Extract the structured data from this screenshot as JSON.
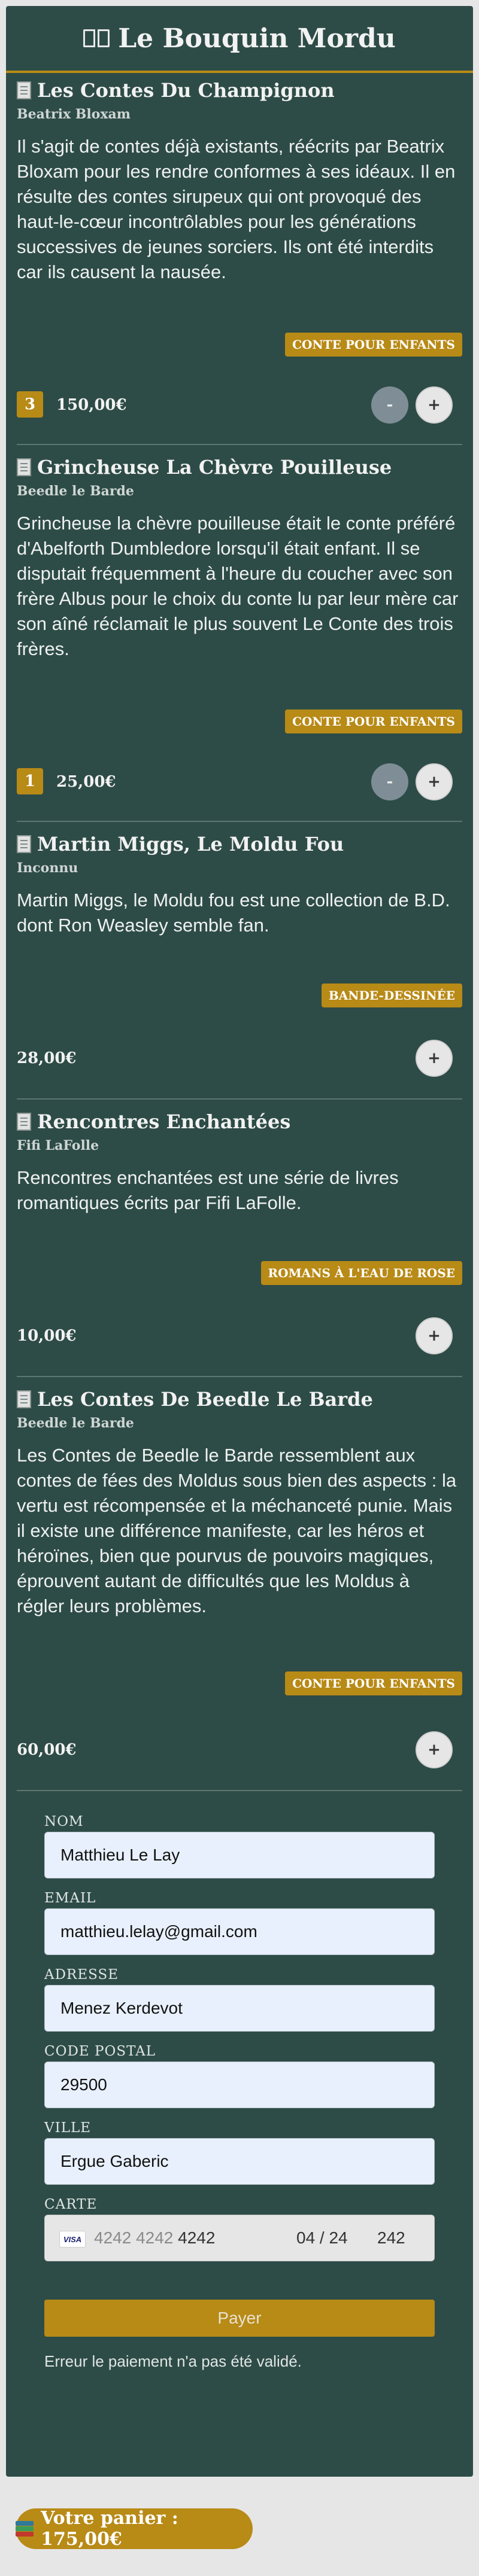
{
  "header": {
    "title": "Le Bouquin Mordu"
  },
  "products": [
    {
      "title": "Les Contes Du Champignon",
      "author": "Beatrix Bloxam",
      "description": "Il s'agit de contes déjà existants, réécrits par Beatrix Bloxam pour les rendre conformes à ses idéaux. Il en résulte des contes sirupeux qui ont provoqué des haut-le-cœur incontrôlables pour les générations successives de jeunes sorciers. Ils ont été interdits car ils causent la nausée.",
      "category": "CONTE POUR ENFANTS",
      "quantity": "3",
      "price": "150,00€",
      "minus_label": "-",
      "plus_label": "+"
    },
    {
      "title": "Grincheuse La Chèvre Pouilleuse",
      "author": "Beedle le Barde",
      "description": "Grincheuse la chèvre pouilleuse était le conte préféré d'Abelforth Dumbledore lorsqu'il était enfant. Il se disputait fréquemment à l'heure du coucher avec son frère Albus pour le choix du conte lu par leur mère car son aîné réclamait le plus souvent Le Conte des trois frères.",
      "category": "CONTE POUR ENFANTS",
      "quantity": "1",
      "price": "25,00€",
      "minus_label": "-",
      "plus_label": "+"
    },
    {
      "title": "Martin Miggs, Le Moldu Fou",
      "author": "Inconnu",
      "description": "Martin Miggs, le Moldu fou est une collection de B.D. dont Ron Weasley semble fan.",
      "category": "BANDE-DESSINÉE",
      "price": "28,00€",
      "plus_label": "+"
    },
    {
      "title": "Rencontres Enchantées",
      "author": "Fifi LaFolle",
      "description": "Rencontres enchantées est une série de livres romantiques écrits par Fifi LaFolle.",
      "category": "ROMANS À L'EAU DE ROSE",
      "price": "10,00€",
      "plus_label": "+"
    },
    {
      "title": "Les Contes De Beedle Le Barde",
      "author": "Beedle le Barde",
      "description": "Les Contes de Beedle le Barde ressemblent aux contes de fées des Moldus sous bien des aspects : la vertu est récompensée et la méchanceté punie. Mais il existe une différence manifeste, car les héros et héroïnes, bien que pourvus de pouvoirs magiques, éprouvent autant de difficultés que les Moldus à régler leurs problèmes.",
      "category": "CONTE POUR ENFANTS",
      "price": "60,00€",
      "plus_label": "+"
    }
  ],
  "form": {
    "name_label": "NOM",
    "name_value": "Matthieu Le Lay",
    "email_label": "EMAIL",
    "email_value": "matthieu.lelay@gmail.com",
    "address_label": "ADRESSE",
    "address_value": "Menez Kerdevot",
    "postal_label": "CODE POSTAL",
    "postal_value": "29500",
    "city_label": "VILLE",
    "city_value": "Ergue Gaberic",
    "card_label": "CARTE",
    "card_brand": "VISA",
    "card_number_muted": "4242 4242",
    "card_number_last": "4242",
    "card_expiry": "04 / 24",
    "card_cvc": "242",
    "pay_label": "Payer",
    "error_text": "Erreur le paiement n'a pas été validé."
  },
  "cart": {
    "label": "Votre panier : 175,00€"
  },
  "colors": {
    "panel": "#2e4c47",
    "accent": "#b88a16",
    "page": "#e6e6e6"
  }
}
